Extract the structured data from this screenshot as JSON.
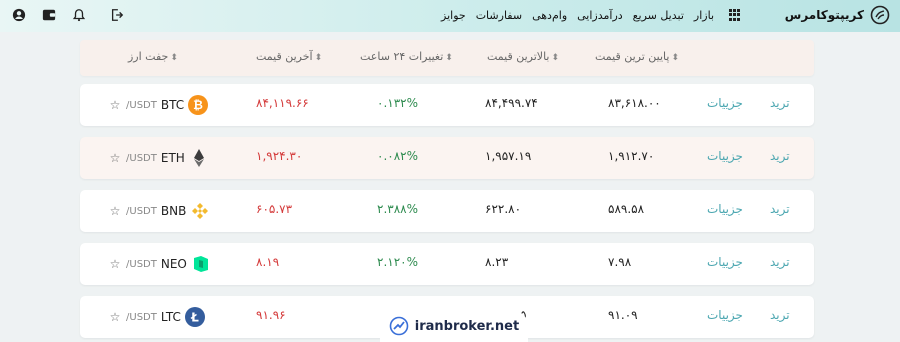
{
  "nav": {
    "brand": "کریپتوکامرس",
    "menu": [
      "بازار",
      "تبدیل سریع",
      "درآمدزایی",
      "وام‌دهی",
      "سفارشات",
      "جوایز"
    ]
  },
  "table": {
    "headers": {
      "pair": "جفت ارز",
      "last_price": "آخرین قیمت",
      "change_24h": "تغییرات ۲۴ ساعت",
      "high": "بالاترین قیمت",
      "low": "پایین ترین قیمت"
    },
    "rows": [
      {
        "symbol": "BTC",
        "quote": "/USDT",
        "last_price": "۸۴,۱۱۹.۶۶",
        "change": "۰.۱۳۲%",
        "high": "۸۴,۴۹۹.۷۴",
        "low": "۸۳,۶۱۸.۰۰",
        "details": "جزییات",
        "trade": "ترید",
        "coin_color": "#f7931a"
      },
      {
        "symbol": "ETH",
        "quote": "/USDT",
        "last_price": "۱,۹۲۴.۳۰",
        "change": "۰.۰۸۲%",
        "high": "۱,۹۵۷.۱۹",
        "low": "۱,۹۱۲.۷۰",
        "details": "جزییات",
        "trade": "ترید",
        "coin_color": "#3c3c3d"
      },
      {
        "symbol": "BNB",
        "quote": "/USDT",
        "last_price": "۶۰۵.۷۳",
        "change": "۲.۳۸۸%",
        "high": "۶۲۲.۸۰",
        "low": "۵۸۹.۵۸",
        "details": "جزییات",
        "trade": "ترید",
        "coin_color": "#f3ba2f"
      },
      {
        "symbol": "NEO",
        "quote": "/USDT",
        "last_price": "۸.۱۹",
        "change": "۲.۱۲۰%",
        "high": "۸.۲۳",
        "low": "۷.۹۸",
        "details": "جزییات",
        "trade": "ترید",
        "coin_color": "#00e599"
      },
      {
        "symbol": "LTC",
        "quote": "/USDT",
        "last_price": "۹۱.۹۶",
        "change": "",
        "high": "۵",
        "low": "۹۱.۰۹",
        "details": "جزییات",
        "trade": "ترید",
        "coin_color": "#345d9d"
      }
    ]
  },
  "watermark": "iranbroker.net"
}
